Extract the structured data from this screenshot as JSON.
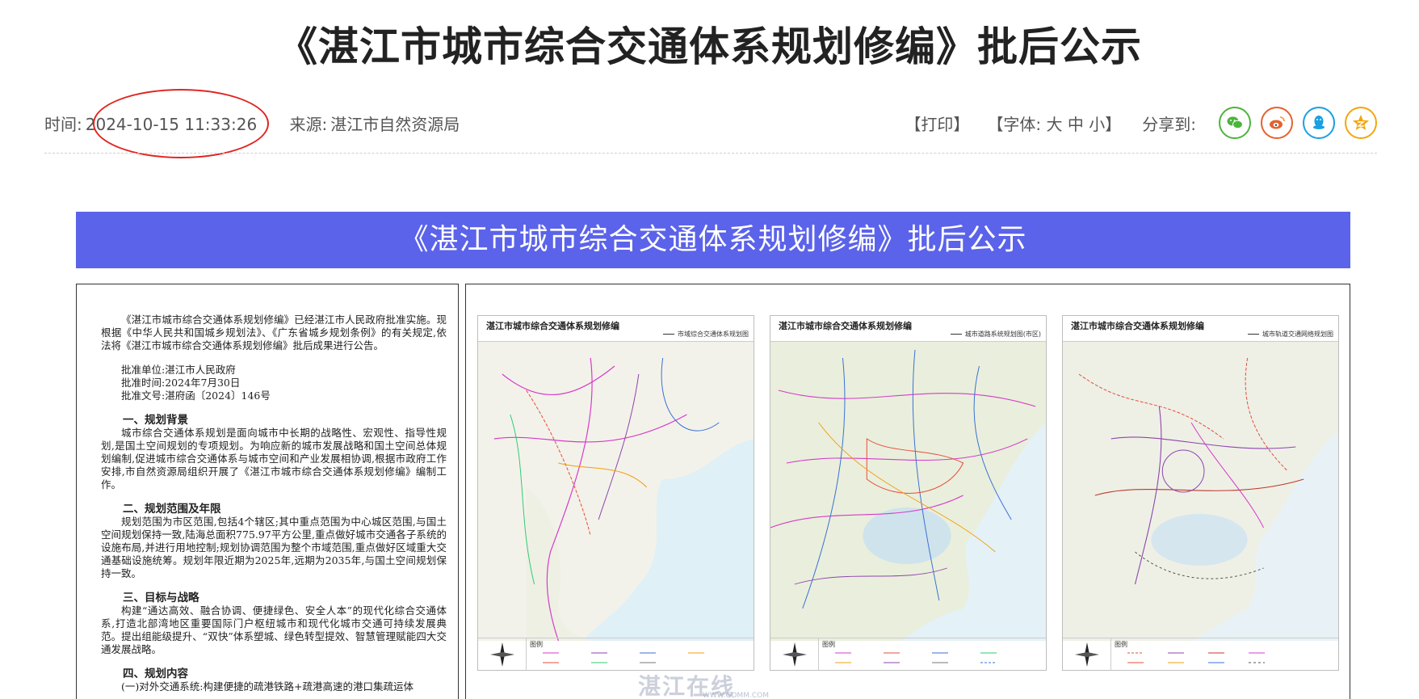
{
  "header": {
    "title": "《湛江市城市综合交通体系规划修编》批后公示"
  },
  "meta": {
    "time_label": "时间:",
    "time_value": "2024-10-15 11:33:26",
    "source_label": "来源:",
    "source_value": "湛江市自然资源局",
    "print_label": "【打印】",
    "font_label": "【字体: 大 中 小】",
    "share_label": "分享到:",
    "share_icons": [
      "wechat-icon",
      "weibo-icon",
      "qq-icon",
      "qzone-icon"
    ],
    "colors": {
      "wechat": "#4cb43b",
      "weibo": "#e6612f",
      "qq": "#1aa0e3",
      "qzone": "#f4a60d",
      "circle": "#e0241f"
    }
  },
  "banner": {
    "text": "《湛江市城市综合交通体系规划修编》批后公示",
    "color": "#5b63ea"
  },
  "notice": {
    "intro": "《湛江市城市综合交通体系规划修编》已经湛江市人民政府批准实施。现根据《中华人民共和国城乡规划法》、《广东省城乡规划条例》的有关规定,依法将《湛江市城市综合交通体系规划修编》批后成果进行公告。",
    "approval_unit": "批准单位:湛江市人民政府",
    "approval_time": "批准时间:2024年7月30日",
    "approval_doc": "批准文号:湛府函〔2024〕146号",
    "s1_title": "一、规划背景",
    "s1_text": "城市综合交通体系规划是面向城市中长期的战略性、宏观性、指导性规划,是国土空间规划的专项规划。为响应新的城市发展战略和国土空间总体规划编制,促进城市综合交通体系与城市空间和产业发展相协调,根据市政府工作安排,市自然资源局组织开展了《湛江市城市综合交通体系规划修编》编制工作。",
    "s2_title": "二、规划范围及年限",
    "s2_text": "规划范围为市区范围,包括4个辖区;其中重点范围为中心城区范围,与国土空间规划保持一致,陆海总面积775.97平方公里,重点做好城市交通各子系统的设施布局,并进行用地控制;规划协调范围为整个市域范围,重点做好区域重大交通基础设施统筹。规划年限近期为2025年,远期为2035年,与国土空间规划保持一致。",
    "s3_title": "三、目标与战略",
    "s3_text": "构建“通达高效、融合协调、便捷绿色、安全人本”的现代化综合交通体系,打造北部湾地区重要国际门户枢纽城市和现代化城市交通可持续发展典范。提出组能级提升、“双快”体系塑城、绿色转型提效、智慧管理赋能四大交通发展战略。",
    "s4_title": "四、规划内容",
    "s4_text": "(一)对外交通系统:构建便捷的疏港铁路+疏港高速的港口集疏运体"
  },
  "maps": [
    {
      "title": "湛江市城市综合交通体系规划修编",
      "subtitle": "市域综合交通体系规划图",
      "legend": "图例"
    },
    {
      "title": "湛江市城市综合交通体系规划修编",
      "subtitle": "城市道路系统规划图(市区)",
      "legend": "图例"
    },
    {
      "title": "湛江市城市综合交通体系规划修编",
      "subtitle": "城市轨道交通网络规划图",
      "legend": "图例"
    }
  ],
  "watermark": {
    "text": "湛江在线",
    "url": "WWW.GDMM.COM"
  }
}
